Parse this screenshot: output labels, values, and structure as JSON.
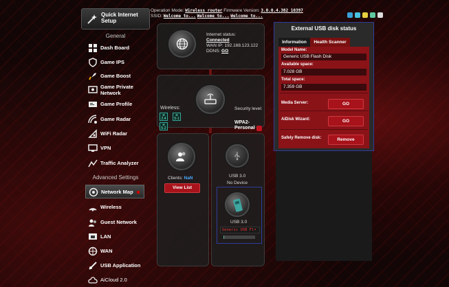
{
  "header": {
    "op_mode_label": "Operation Mode:",
    "op_mode_value": "Wireless router",
    "firmware_label": "Firmware Version:",
    "firmware_value": "3.0.0.4.382_10397",
    "ssid_label": "SSID:",
    "ssid_1": "Welcome to...",
    "ssid_2": "Welcome to...",
    "ssid_3": "Welcome to..."
  },
  "sidebar": {
    "quick_setup": "Quick Internet Setup",
    "general_heading": "General",
    "general_items": [
      {
        "label": "Dash Board",
        "icon": "dashboard-icon"
      },
      {
        "label": "Game IPS",
        "icon": "shield-icon"
      },
      {
        "label": "Game Boost",
        "icon": "rocket-icon"
      },
      {
        "label": "Game Private Network",
        "icon": "network-icon"
      },
      {
        "label": "Game Profile",
        "icon": "profile-icon"
      },
      {
        "label": "Game Radar",
        "icon": "radar-icon"
      },
      {
        "label": "WiFi Radar",
        "icon": "wifi-radar-icon"
      },
      {
        "label": "VPN",
        "icon": "vpn-icon"
      },
      {
        "label": "Traffic Analyzer",
        "icon": "traffic-icon"
      }
    ],
    "advanced_heading": "Advanced Settings",
    "advanced_items": [
      {
        "label": "Network Map",
        "icon": "network-map-icon"
      },
      {
        "label": "Wireless",
        "icon": "wireless-icon"
      },
      {
        "label": "Guest Network",
        "icon": "guest-icon"
      },
      {
        "label": "LAN",
        "icon": "lan-icon"
      },
      {
        "label": "WAN",
        "icon": "globe-icon"
      },
      {
        "label": "USB Application",
        "icon": "usb-app-icon"
      },
      {
        "label": "AiCloud 2.0",
        "icon": "cloud-icon"
      }
    ]
  },
  "internet": {
    "status_label": "Internet status:",
    "status_value": "Connected",
    "wan_ip": "WAN IP: 192.168.123.122",
    "ddns_label": "DDNS:",
    "ddns_value": "GO"
  },
  "wireless": {
    "label": "Wireless:",
    "badges": [
      "2.4",
      "5-1",
      "5-2"
    ],
    "security_label": "Security level:",
    "security_value": "WPA2-Personal"
  },
  "clients": {
    "label": "Clients:",
    "value": "NaN",
    "button": "View List"
  },
  "usb1": {
    "label": "USB 3.0",
    "device": "No Device"
  },
  "usb2": {
    "label": "USB 3.0",
    "select_value": "Generic USB Fl▾"
  },
  "usb_status": {
    "title": "External USB disk status",
    "tab_info": "Information",
    "tab_health": "Health Scanner",
    "model_label": "Model Name:",
    "model_value": "Generic USB Flash Disk",
    "available_label": "Available space:",
    "available_value": "7.028 GB",
    "total_label": "Total space:",
    "total_value": "7.359 GB",
    "media_label": "Media Server:",
    "media_button": "GO",
    "aidisk_label": "AiDisk Wizard:",
    "aidisk_button": "GO",
    "remove_label": "Safely Remove disk:",
    "remove_button": "Remove"
  },
  "colors": {
    "accent_red": "#a8121a",
    "highlight_blue": "#2e3c9a",
    "clients_value": "#4aa8ff"
  }
}
